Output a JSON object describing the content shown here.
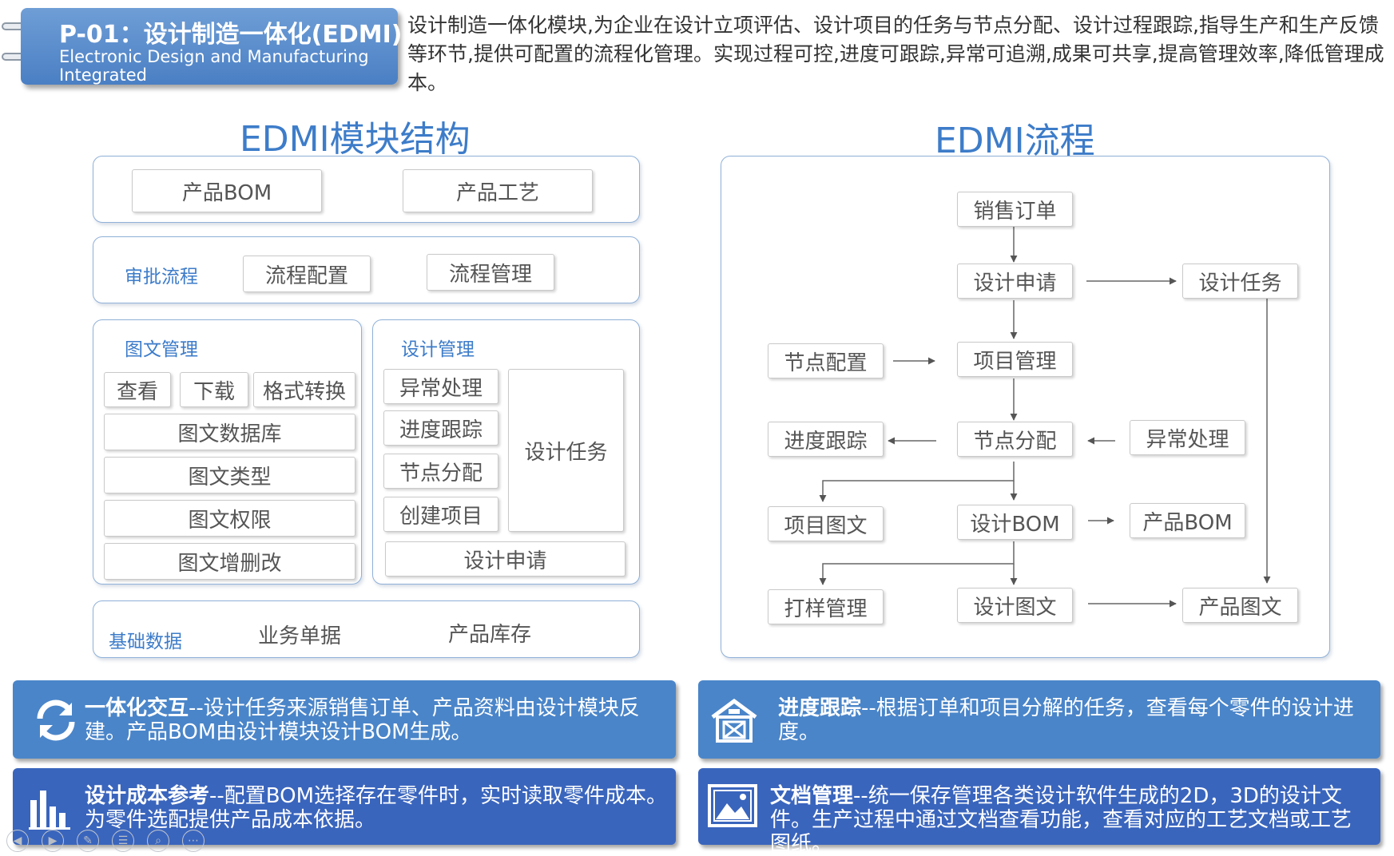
{
  "header": {
    "title": "P-01：设计制造一体化(EDMI)",
    "subtitle": "Electronic Design and Manufacturing Integrated",
    "intro": "设计制造一体化模块,为企业在设计立项评估、设计项目的任务与节点分配、设计过程跟踪,指导生产和生产反馈等环节,提供可配置的流程化管理。实现过程可控,进度可跟踪,异常可追溯,成果可共享,提高管理效率,降低管理成本。"
  },
  "structure": {
    "title": "EDMI模块结构",
    "row1": [
      "产品BOM",
      "产品工艺"
    ],
    "approval": {
      "label": "审批流程",
      "items": [
        "流程配置",
        "流程管理"
      ]
    },
    "graphic": {
      "label": "图文管理",
      "top": [
        "查看",
        "下载",
        "格式转换"
      ],
      "rows": [
        "图文数据库",
        "图文类型",
        "图文权限",
        "图文增删改"
      ]
    },
    "design": {
      "label": "设计管理",
      "left": [
        "异常处理",
        "进度跟踪",
        "节点分配",
        "创建项目"
      ],
      "task": "设计任务",
      "apply": "设计申请"
    },
    "base": {
      "label": "基础数据",
      "items": [
        "业务单据",
        "产品库存"
      ]
    }
  },
  "flow": {
    "title": "EDMI流程",
    "nodes": {
      "sales_order": "销售订单",
      "design_apply": "设计申请",
      "design_task": "设计任务",
      "node_config": "节点配置",
      "project_mgmt": "项目管理",
      "progress": "进度跟踪",
      "node_assign": "节点分配",
      "exception": "异常处理",
      "project_doc": "项目图文",
      "design_bom": "设计BOM",
      "product_bom": "产品BOM",
      "sample_mgmt": "打样管理",
      "design_doc": "设计图文",
      "product_doc": "产品图文"
    }
  },
  "cards": [
    {
      "icon": "sync-icon",
      "title": "一体化交互",
      "text": "--设计任务来源销售订单、产品资料由设计模块反建。产品BOM由设计模块设计BOM生成。",
      "color": "#4a85c9"
    },
    {
      "icon": "warehouse-icon",
      "title": "进度跟踪",
      "text": "--根据订单和项目分解的任务，查看每个零件的设计进度。",
      "color": "#4a85c9"
    },
    {
      "icon": "bar-chart-icon",
      "title": "设计成本参考",
      "text": "--配置BOM选择存在零件时，实时读取零件成本。为零件选配提供产品成本依据。",
      "color": "#3a65bd"
    },
    {
      "icon": "image-icon",
      "title": "文档管理",
      "text": "--统一保存管理各类设计软件生成的2D，3D的设计文件。生产过程中通过文档查看功能，查看对应的工艺文档或工艺图纸。",
      "color": "#3a65bd"
    }
  ],
  "nav": [
    "prev-icon",
    "next-icon",
    "pen-icon",
    "menu-icon",
    "zoom-icon",
    "more-icon"
  ]
}
